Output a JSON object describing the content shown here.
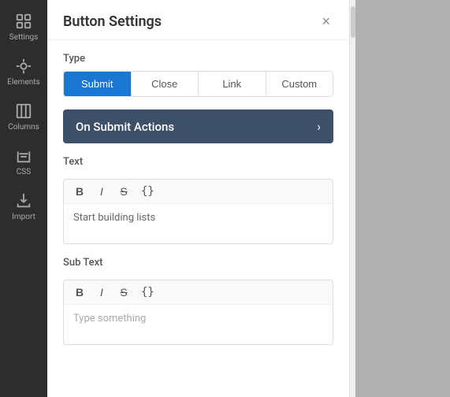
{
  "sidebar": {
    "items": [
      {
        "label": "Settings",
        "icon": "settings-icon"
      },
      {
        "label": "Elements",
        "icon": "elements-icon"
      },
      {
        "label": "Columns",
        "icon": "columns-icon"
      },
      {
        "label": "CSS",
        "icon": "css-icon"
      },
      {
        "label": "Import",
        "icon": "import-icon"
      }
    ]
  },
  "dialog": {
    "title": "Button Settings",
    "close_label": "×",
    "type_section": {
      "label": "Type",
      "buttons": [
        {
          "label": "Submit",
          "active": true
        },
        {
          "label": "Close",
          "active": false
        },
        {
          "label": "Link",
          "active": false
        },
        {
          "label": "Custom",
          "active": false
        }
      ]
    },
    "action_bar": {
      "label": "On Submit Actions",
      "arrow": "›"
    },
    "text_section": {
      "label": "Text",
      "toolbar": [
        {
          "label": "B",
          "style": "bold",
          "name": "bold-btn"
        },
        {
          "label": "I",
          "style": "italic",
          "name": "italic-btn"
        },
        {
          "label": "S",
          "style": "strike",
          "name": "strike-btn"
        },
        {
          "label": "{}",
          "style": "code",
          "name": "code-btn"
        }
      ],
      "content": "Start building lists"
    },
    "sub_text_section": {
      "label": "Sub Text",
      "toolbar": [
        {
          "label": "B",
          "style": "bold",
          "name": "bold-btn-2"
        },
        {
          "label": "I",
          "style": "italic",
          "name": "italic-btn-2"
        },
        {
          "label": "S",
          "style": "strike",
          "name": "strike-btn-2"
        },
        {
          "label": "{}",
          "style": "code",
          "name": "code-btn-2"
        }
      ],
      "placeholder": "Type something"
    }
  }
}
